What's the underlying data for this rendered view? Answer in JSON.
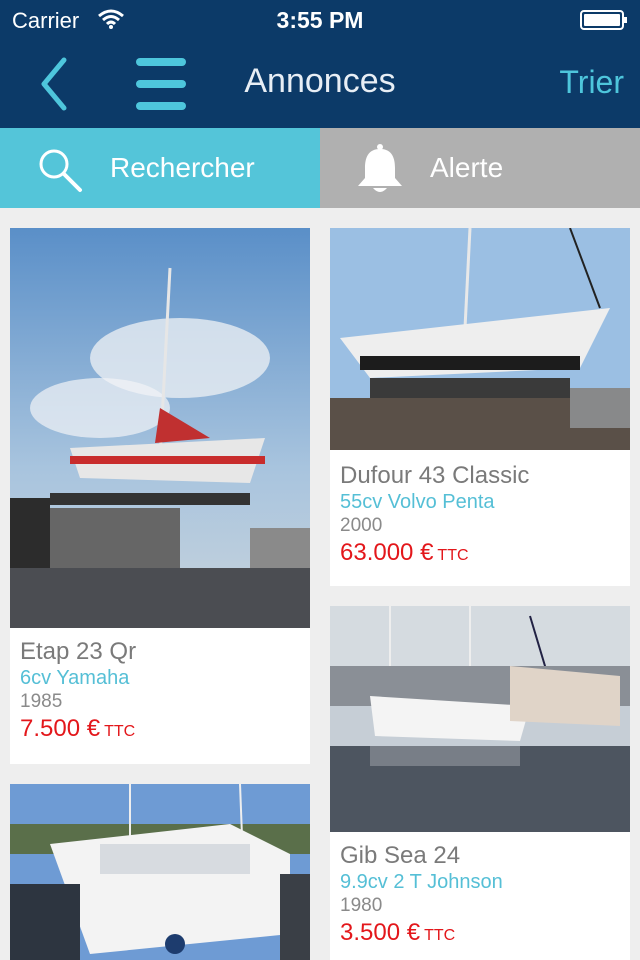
{
  "status_bar": {
    "carrier": "Carrier",
    "time": "3:55 PM"
  },
  "nav": {
    "title": "Annonces",
    "sort_label": "Trier"
  },
  "tabs": [
    {
      "label": "Rechercher",
      "icon": "search-icon"
    },
    {
      "label": "Alerte",
      "icon": "bell-icon"
    }
  ],
  "listings": [
    {
      "title": "Etap 23 Qr",
      "engine": "6cv Yamaha",
      "year": "1985",
      "price": "7.500 €",
      "price_suffix": "TTC"
    },
    {
      "title": "Dufour 43 Classic",
      "engine": "55cv Volvo Penta",
      "year": "2000",
      "price": "63.000 €",
      "price_suffix": "TTC"
    },
    {
      "title": "Gib Sea 24",
      "engine": "9.9cv 2 T Johnson",
      "year": "1980",
      "price": "3.500 €",
      "price_suffix": "TTC"
    },
    {
      "title": "",
      "engine": "",
      "year": "",
      "price": "",
      "price_suffix": ""
    }
  ],
  "colors": {
    "navy": "#0c3a68",
    "accent": "#54c5d9",
    "price": "#e3171b",
    "tab_inactive": "#b0b0b0"
  }
}
